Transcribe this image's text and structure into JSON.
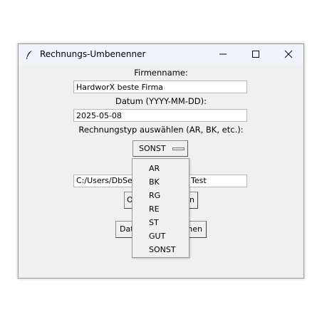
{
  "window": {
    "title": "Rechnungs-Umbenenner"
  },
  "form": {
    "company_label": "Firmenname:",
    "company_value": "HardworX beste Firma",
    "date_label": "Datum (YYYY-MM-DD):",
    "date_value": "2025-05-08",
    "type_label": "Rechnungstyp auswählen (AR, BK, etc.):",
    "type_selected": "SONST",
    "path_value": "C:/Users/DbSek",
    "path_value_tail": "Test",
    "open_button_start": "O",
    "open_button_end": "n",
    "run_button_start": "Dat",
    "run_button_end": "nen"
  },
  "dropdown": {
    "options": [
      "AR",
      "BK",
      "RG",
      "RE",
      "ST",
      "GUT",
      "SONST"
    ]
  }
}
